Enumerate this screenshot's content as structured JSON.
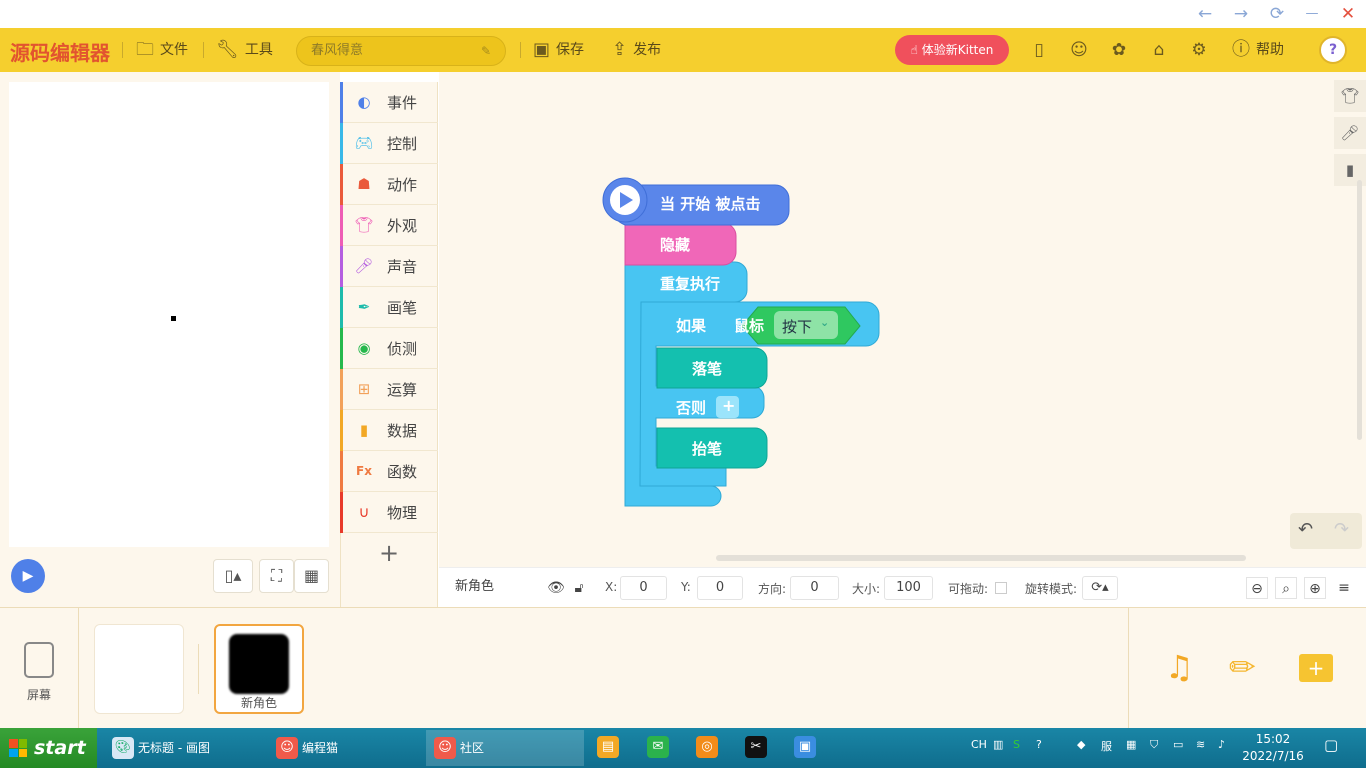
{
  "window": {
    "back": "←",
    "forward": "→",
    "refresh": "⟳",
    "minimize": "—",
    "close": "✕"
  },
  "header": {
    "logo": "源码编辑器",
    "file_label": "文件",
    "tools_label": "工具",
    "project_name": "春风得意",
    "save_label": "保存",
    "publish_label": "发布",
    "kitten_label": "体验新Kitten",
    "help_label": "帮助",
    "avatar_letter": "?"
  },
  "categories": [
    {
      "label": "事件",
      "color": "#4f80e8",
      "icon": "toggle"
    },
    {
      "label": "控制",
      "color": "#39b8e8",
      "icon": "gamepad"
    },
    {
      "label": "动作",
      "color": "#ea5a3b",
      "icon": "ghost"
    },
    {
      "label": "外观",
      "color": "#ee5db5",
      "icon": "shirt"
    },
    {
      "label": "声音",
      "color": "#b55ee0",
      "icon": "mic"
    },
    {
      "label": "画笔",
      "color": "#1ebbab",
      "icon": "pen"
    },
    {
      "label": "侦测",
      "color": "#25b84c",
      "icon": "radar"
    },
    {
      "label": "运算",
      "color": "#f2a15a",
      "icon": "calc"
    },
    {
      "label": "数据",
      "color": "#f2a825",
      "icon": "chart"
    },
    {
      "label": "函数",
      "color": "#ef7a41",
      "icon": "fx"
    },
    {
      "label": "物理",
      "color": "#e83a2a",
      "icon": "magnet"
    }
  ],
  "blocks": {
    "hat": "当 开始 被点击",
    "hide": "隐藏",
    "repeat": "重复执行",
    "if": "如果",
    "mouse": "鼠标",
    "pressed": "按下",
    "pen_down": "落笔",
    "else": "否则",
    "pen_up": "抬笔"
  },
  "props": {
    "sprite_name": "新角色",
    "x_label": "X:",
    "x_value": "0",
    "y_label": "Y:",
    "y_value": "0",
    "dir_label": "方向:",
    "dir_value": "0",
    "size_label": "大小:",
    "size_value": "100",
    "draggable_label": "可拖动:",
    "rotate_label": "旋转模式:"
  },
  "sprites": {
    "screen_label": "屏幕",
    "sprite_name": "新角色"
  },
  "taskbar": {
    "start": "start",
    "tasks": [
      {
        "label": "无标题 - 画图"
      },
      {
        "label": "编程猫"
      },
      {
        "label": "社区"
      }
    ],
    "ime": "CH",
    "time": "15:02",
    "date": "2022/7/16"
  }
}
